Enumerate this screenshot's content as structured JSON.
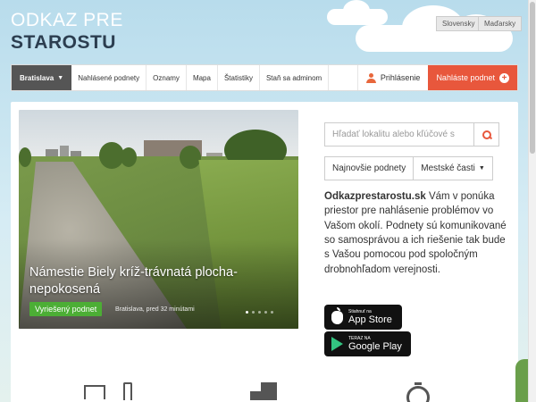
{
  "header": {
    "logo_line1": "ODKAZ PRE",
    "logo_line2": "STAROSTU",
    "languages": [
      "Slovensky",
      "Maďarsky"
    ]
  },
  "nav": {
    "city": "Bratislava",
    "items": [
      "Nahlásené podnety",
      "Oznamy",
      "Mapa",
      "Štatistiky",
      "Staň sa adminom"
    ],
    "login": "Prihlásenie",
    "report": "Nahláste podnet"
  },
  "hero": {
    "title": "Námestie Biely kríž-trávnatá plocha-nepokosená",
    "status": "Vyriešený podnet",
    "meta": "Bratislava, pred 32 minútami",
    "slides": 5,
    "active_slide": 1
  },
  "search": {
    "placeholder": "Hľadať lokalitu alebo kľúčové s"
  },
  "filters": {
    "newest": "Najnovšie podnety",
    "districts": "Mestské časti"
  },
  "about": {
    "brand": "Odkazprestarostu.sk",
    "text": " Vám v ponúka priestor pre nahlásenie problémov vo Vašom okolí. Podnety sú komunikované so samosprávou a ich riešenie tak bude s Vašou pomocou pod spoločným drobnohľadom verejnosti."
  },
  "stores": {
    "apple_small": "Stiahnuť na",
    "apple_big": "App Store",
    "google_small": "TERAZ NA",
    "google_big": "Google Play"
  },
  "colors": {
    "accent": "#e8573c",
    "nav_active": "#555555",
    "status_green": "#4cae35",
    "logo_dark": "#2c3e50"
  }
}
